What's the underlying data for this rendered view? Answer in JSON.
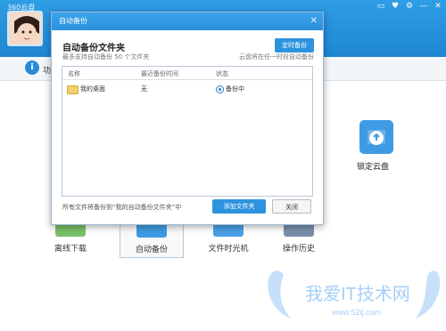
{
  "app": {
    "title": "360云盘",
    "window_controls": [
      "▭",
      "♥",
      "⚙",
      "—",
      "✕"
    ],
    "info_text": "功"
  },
  "right_panel": {
    "lock_label": "锁定云盘"
  },
  "bottom_items": [
    {
      "label": "离线下载"
    },
    {
      "label": "自动备份"
    },
    {
      "label": "文件时光机"
    },
    {
      "label": "操作历史"
    }
  ],
  "dialog": {
    "title": "自动备份",
    "heading": "自动备份文件夹",
    "subtext": "最多支持自动备份 50 个文件夹",
    "timer_button": "定时备份",
    "cloud_note": "云盘将在任一时段自动备份",
    "table": {
      "headers": [
        "名称",
        "最近备份时间",
        "状态"
      ],
      "rows": [
        {
          "name": "我的桌面",
          "last_backup": "无",
          "status": "备份中"
        }
      ]
    },
    "footer_note": "所有文件将备份到“我的自动备份文件夹”中",
    "add_button": "添加文件夹",
    "close_button": "关闭"
  },
  "watermark": {
    "text": "我爱IT技术网",
    "url": "www.52ij.com"
  },
  "colors": {
    "accent": "#2e93df",
    "header_blue": "#2f9ee6"
  }
}
